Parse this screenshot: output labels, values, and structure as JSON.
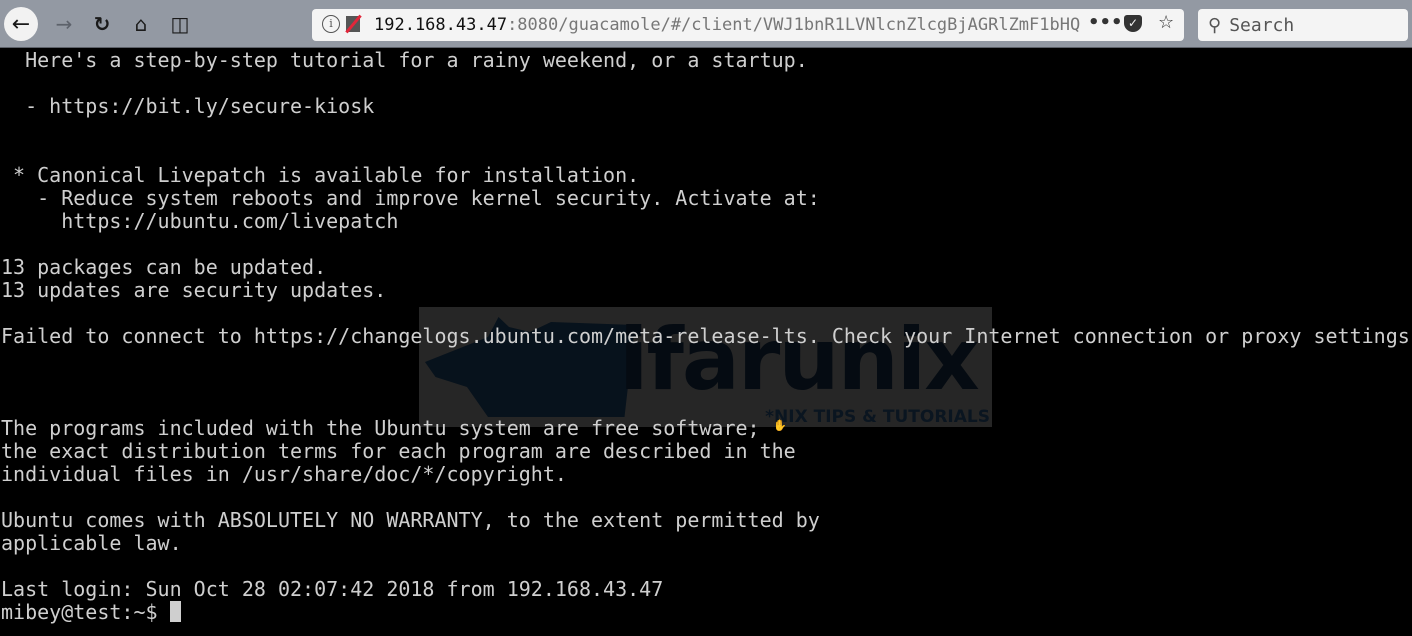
{
  "browser": {
    "icons": [
      "back-icon",
      "forward-icon",
      "reload-icon",
      "home-icon",
      "sidebar-icon",
      "info-icon",
      "insecure-lock-icon",
      "more-icon",
      "pocket-icon",
      "bookmark-star-icon",
      "search-icon"
    ],
    "url_host": "192.168.43.47",
    "url_rest": ":8080/guacamole/#/client/VWJ1bnR1LVNlcnZlcgBjAGRlZmF1bHQ",
    "search_placeholder": "Search"
  },
  "watermark": {
    "brand": "Kifarunix",
    "tagline": "*NIX TIPS & TUTORIALS"
  },
  "terminal": {
    "lines": [
      "  Here's a step-by-step tutorial for a rainy weekend, or a startup.",
      "",
      "  - https://bit.ly/secure-kiosk",
      "",
      "",
      " * Canonical Livepatch is available for installation.",
      "   - Reduce system reboots and improve kernel security. Activate at:",
      "     https://ubuntu.com/livepatch",
      "",
      "13 packages can be updated.",
      "13 updates are security updates.",
      "",
      "Failed to connect to https://changelogs.ubuntu.com/meta-release-lts. Check your Internet connection or proxy settings",
      "",
      "",
      "",
      "The programs included with the Ubuntu system are free software;",
      "the exact distribution terms for each program are described in the",
      "individual files in /usr/share/doc/*/copyright.",
      "",
      "Ubuntu comes with ABSOLUTELY NO WARRANTY, to the extent permitted by",
      "applicable law.",
      "",
      "Last login: Sun Oct 28 02:07:42 2018 from 192.168.43.47"
    ],
    "prompt": "mibey@test:~$"
  }
}
